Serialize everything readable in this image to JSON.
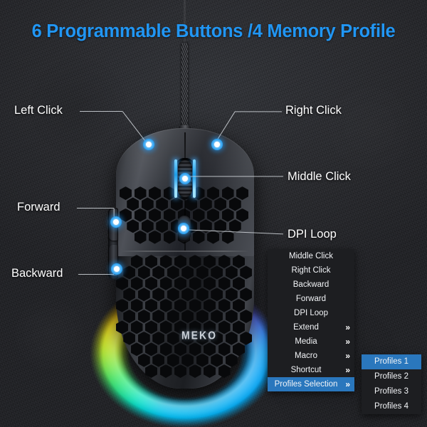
{
  "title": "6 Programmable Buttons /4 Memory Profile",
  "accent_color": "#2196f3",
  "menu_highlight_color": "#2a77bd",
  "background_color": "#2b2c30",
  "product": {
    "logo_text": "MEKO",
    "device": "gaming-mouse"
  },
  "callouts": [
    {
      "label": "Left Click",
      "name": "callout-left-click"
    },
    {
      "label": "Right Click",
      "name": "callout-right-click"
    },
    {
      "label": "Middle Click",
      "name": "callout-middle-click"
    },
    {
      "label": "Forward",
      "name": "callout-forward"
    },
    {
      "label": "DPI Loop",
      "name": "callout-dpi-loop"
    },
    {
      "label": "Backward",
      "name": "callout-backward"
    }
  ],
  "context_menu": {
    "items": [
      {
        "label": "Middle Click",
        "submenu": false,
        "selected": false
      },
      {
        "label": "Right Click",
        "submenu": false,
        "selected": false
      },
      {
        "label": "Backward",
        "submenu": false,
        "selected": false
      },
      {
        "label": "Forward",
        "submenu": false,
        "selected": false
      },
      {
        "label": "DPI Loop",
        "submenu": false,
        "selected": false
      },
      {
        "label": "Extend",
        "submenu": true,
        "selected": false
      },
      {
        "label": "Media",
        "submenu": true,
        "selected": false
      },
      {
        "label": "Macro",
        "submenu": true,
        "selected": false
      },
      {
        "label": "Shortcut",
        "submenu": true,
        "selected": false
      },
      {
        "label": "Profiles Selection",
        "submenu": true,
        "selected": true
      }
    ],
    "chevron": "»"
  },
  "submenu": {
    "items": [
      {
        "label": "Profiles 1",
        "selected": true
      },
      {
        "label": "Profiles 2",
        "selected": false
      },
      {
        "label": "Profiles 3",
        "selected": false
      },
      {
        "label": "Profiles 4",
        "selected": false
      }
    ]
  }
}
